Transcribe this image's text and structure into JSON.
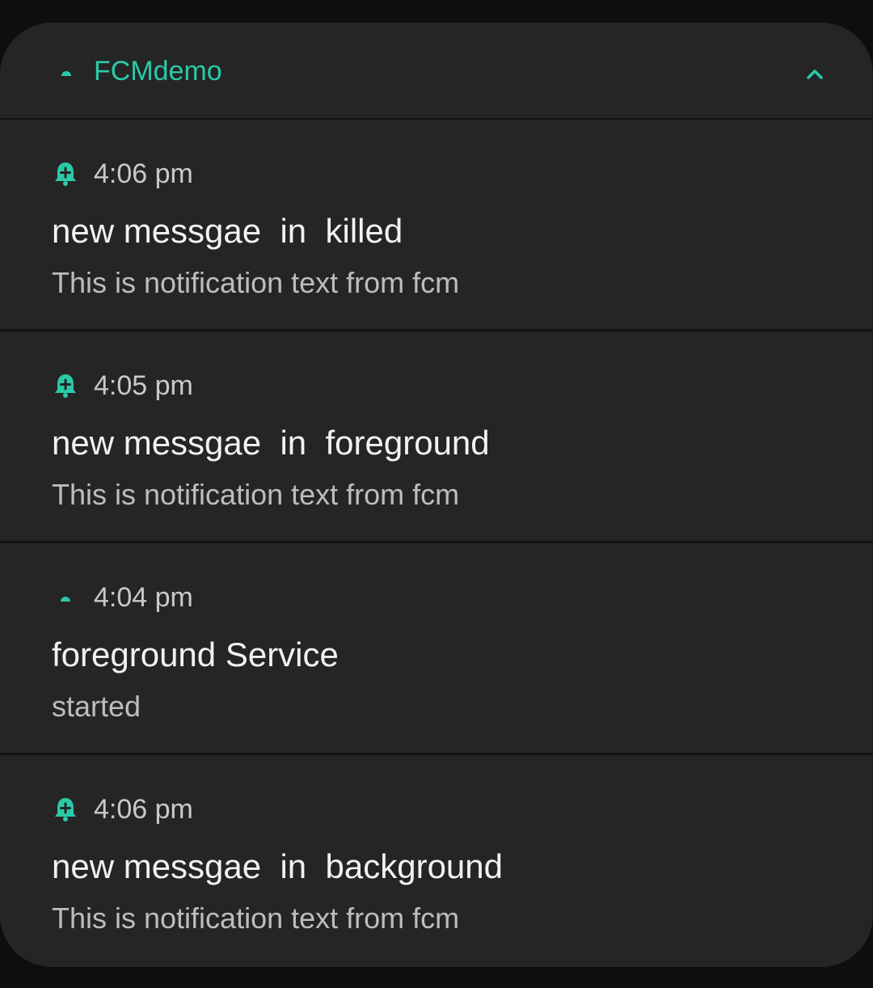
{
  "accent_color": "#2cc9a8",
  "header": {
    "app_name": "FCMdemo",
    "app_icon": "android-dot-icon",
    "collapse_icon": "chevron-up-icon"
  },
  "notifications": [
    {
      "icon": "bell-plus-icon",
      "time": "4:06 pm",
      "title": "new messgae  in  killed",
      "body": "This is notification text from fcm"
    },
    {
      "icon": "bell-plus-icon",
      "time": "4:05 pm",
      "title": "new messgae  in  foreground",
      "body": "This is notification text from fcm"
    },
    {
      "icon": "android-dot-icon",
      "time": "4:04 pm",
      "title": "foreground Service",
      "body": "started"
    },
    {
      "icon": "bell-plus-icon",
      "time": "4:06 pm",
      "title": "new messgae  in  background",
      "body": "This is notification text from fcm"
    }
  ]
}
